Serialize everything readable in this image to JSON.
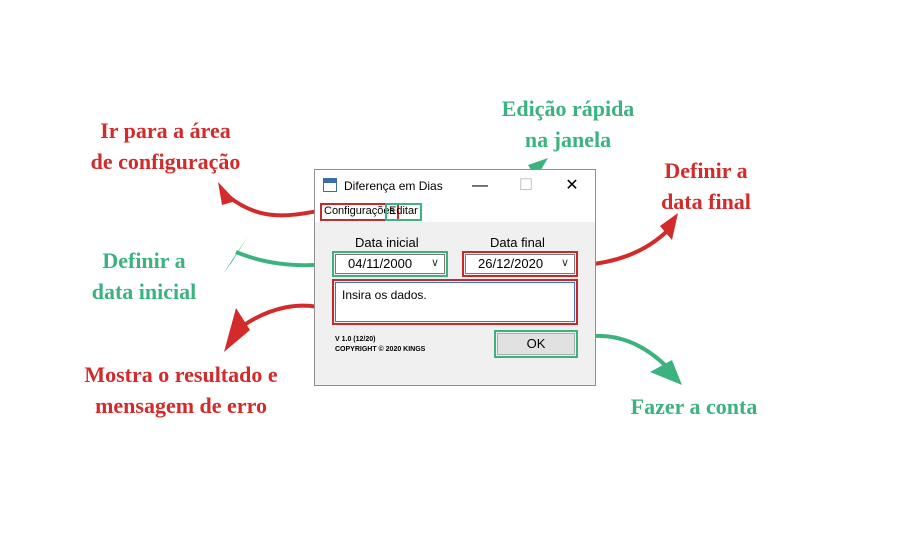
{
  "window": {
    "title": "Diferença em Dias",
    "minimize_glyph": "—",
    "maximize_glyph": "☐",
    "close_glyph": "✕",
    "icon": "calendar-icon"
  },
  "menu": {
    "config_label": "Configurações",
    "edit_label": "Editar"
  },
  "form": {
    "start_label": "Data inicial",
    "start_value": "04/11/2000",
    "end_label": "Data final",
    "end_value": "26/12/2020",
    "result_text": "Insira os dados.",
    "version_line1": "V 1.0 (12/20)",
    "version_line2": "COPYRIGHT © 2020 KINGS",
    "ok_label": "OK"
  },
  "annotations": {
    "config": [
      "Ir para a área",
      "de configuração"
    ],
    "edit": [
      "Edição rápida",
      "na janela"
    ],
    "end_date": [
      "Definir a",
      "data final"
    ],
    "start_date": [
      "Definir a",
      "data inicial"
    ],
    "result": [
      "Mostra o resultado e",
      "mensagem de erro"
    ],
    "ok": [
      "Fazer a conta"
    ]
  },
  "colors": {
    "red": "#d32b2b",
    "green": "#3cb37f"
  }
}
